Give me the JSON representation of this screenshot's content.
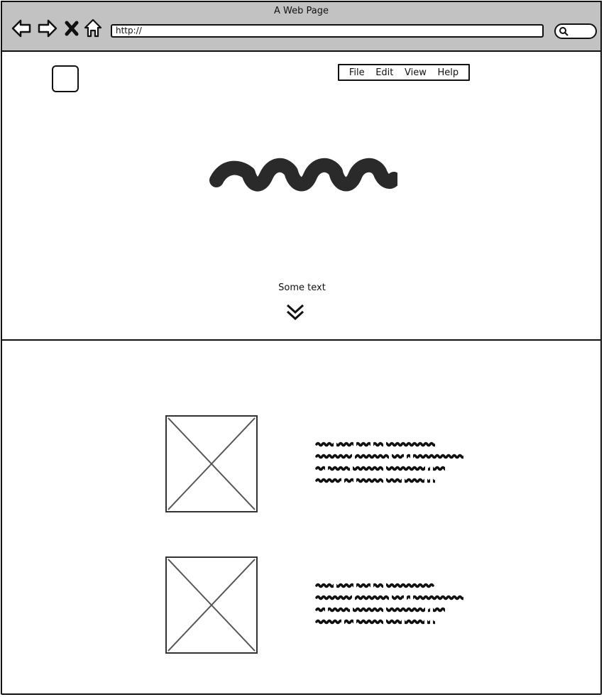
{
  "window": {
    "title": "A Web Page"
  },
  "toolbar": {
    "back_icon": "back-arrow-icon",
    "forward_icon": "forward-arrow-icon",
    "stop_icon": "close-icon",
    "home_icon": "home-icon",
    "url": "http://",
    "search_icon": "search-icon"
  },
  "header": {
    "menu": [
      "File",
      "Edit",
      "View",
      "Help"
    ]
  },
  "hero": {
    "caption": "Some text",
    "scroll_icon": "double-chevron-down-icon"
  },
  "content": {
    "items": [
      {
        "image": "image-placeholder"
      },
      {
        "image": "image-placeholder"
      }
    ]
  }
}
